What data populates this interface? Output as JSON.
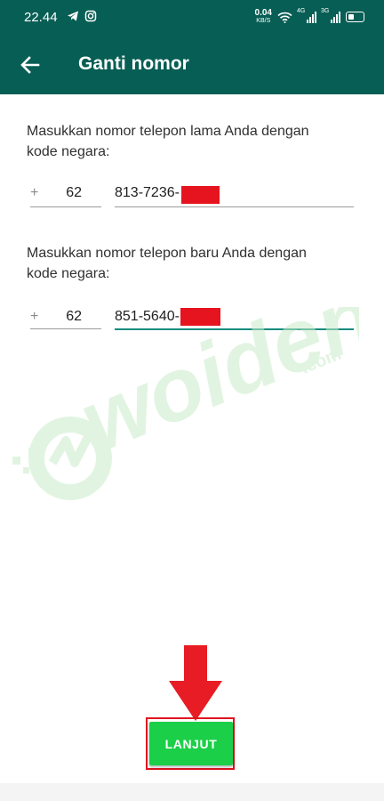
{
  "status_bar": {
    "time": "22.44",
    "net_speed_value": "0.04",
    "net_speed_unit": "KB/S",
    "network_1": "4G",
    "network_2": "3G",
    "icons": [
      "telegram-icon",
      "instagram-icon",
      "wifi-icon",
      "signal-icon",
      "battery-icon"
    ]
  },
  "app_bar": {
    "title": "Ganti nomor",
    "back_icon": "arrow-left-icon"
  },
  "old_number": {
    "label": "Masukkan nomor telepon lama Anda dengan kode negara:",
    "plus": "+",
    "country_code": "62",
    "phone": "813-7236-"
  },
  "new_number": {
    "label": "Masukkan nomor telepon baru Anda dengan kode negara:",
    "plus": "+",
    "country_code": "62",
    "phone": "851-5640-"
  },
  "watermark": {
    "text": "woiden",
    "suffix": ".com"
  },
  "next_button": {
    "label": "LANJUT"
  },
  "colors": {
    "primary": "#075e54",
    "accent": "#128c7e",
    "button": "#1ccf48",
    "highlight": "#e0141d"
  }
}
